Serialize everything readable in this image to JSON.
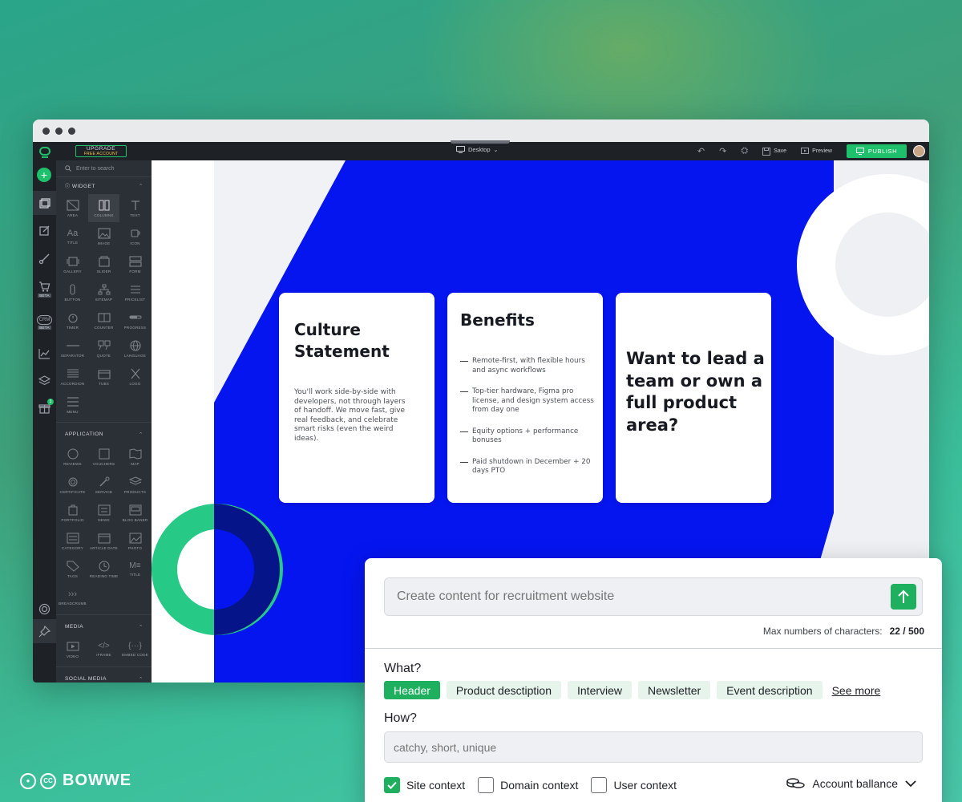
{
  "editor": {
    "upgrade_line1": "UPGRADE",
    "upgrade_line2": "FREE ACCOUNT",
    "device": "Desktop",
    "save": "Save",
    "preview": "Preview",
    "publish": "PUBLISH",
    "rail_beta_1": "BETA",
    "rail_crm": "CRM",
    "rail_beta_2": "BETA",
    "rail_badge": "3"
  },
  "panel": {
    "search_placeholder": "Enter to search",
    "widget_header": "WIDGET",
    "widgets": [
      "AREA",
      "COLUMNS",
      "TEXT",
      "TITLE",
      "IMAGE",
      "ICON",
      "GALLERY",
      "SLIDER",
      "FORM",
      "BUTTON",
      "SITEMAP",
      "PRICELIST",
      "TIMER",
      "COUNTER",
      "PROGRESS",
      "SEPARATOR",
      "QUOTE",
      "LANGUAGE",
      "ACCORDION",
      "TUBS",
      "LOGO",
      "MENU"
    ],
    "application_header": "APPLICATION",
    "application": [
      "REVIEWS",
      "VOUCHERS",
      "MAP",
      "CERTIFICATE",
      "SERVICE",
      "PRODUCTS",
      "PORTFOLIO",
      "NEWS",
      "BLOG BANER",
      "CATEGORY",
      "ARTICLE DATE",
      "PHOTO",
      "TAGS",
      "READING TIME",
      "TITLE",
      "BREADCRUMB"
    ],
    "media_header": "MEDIA",
    "media": [
      "VIDEO",
      "IFRAME",
      "EMBED CODE"
    ],
    "social_header": "SOCIAL MEDIA"
  },
  "canvas": {
    "card1_title": "Culture Statement",
    "card1_body": "You'll work side-by-side with developers, not through layers of handoff. We move fast, give real feedback, and celebrate smart risks (even the weird ideas).",
    "card2_title": "Benefits",
    "card2_items": [
      "Remote-first, with flexible hours and async workflows",
      "Top-tier hardware, Figma pro license, and design system access from day one",
      "Equity options + performance bonuses",
      "Paid shutdown in December + 20 days PTO"
    ],
    "card3_title": "Want to lead a team or own a full product area?"
  },
  "ai": {
    "prompt_placeholder": "Create content for recruitment website",
    "limit_label": "Max numbers of characters:",
    "limit_value": "22 / 500",
    "what_label": "What?",
    "chips": [
      "Header",
      "Product desctiption",
      "Interview",
      "Newsletter",
      "Event description"
    ],
    "see_more": "See more",
    "how_label": "How?",
    "how_placeholder": "catchy, short, unique",
    "checks": [
      "Site context",
      "Domain context",
      "User context"
    ],
    "account": "Account ballance"
  },
  "brand": {
    "cc": "CC",
    "name": "BOWWE"
  },
  "colors": {
    "accent": "#1fb05f",
    "canvas_blue": "#0515f0",
    "teal_ring": "#27c986"
  }
}
